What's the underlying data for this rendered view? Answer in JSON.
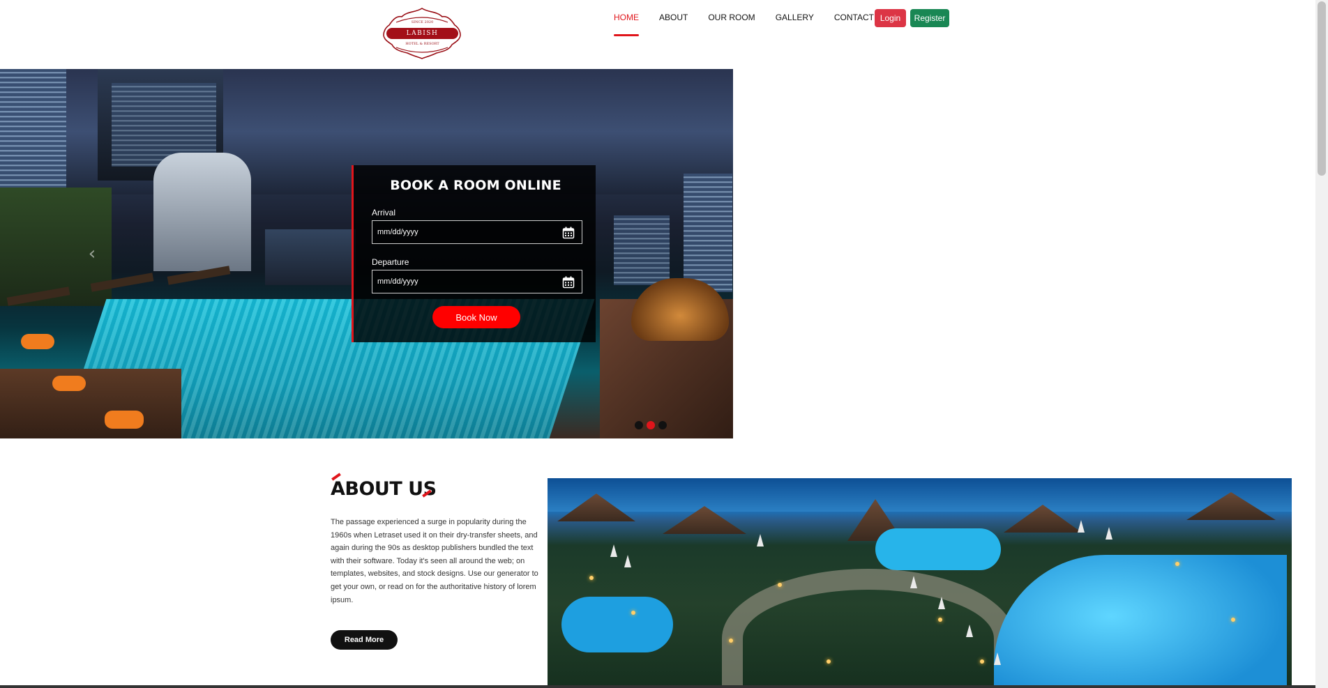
{
  "header": {
    "logo": {
      "top_text": "SINCE 2020",
      "name": "LABISH",
      "tagline": "HOTEL & RESORT"
    },
    "nav": [
      {
        "label": "HOME",
        "active": true
      },
      {
        "label": "ABOUT",
        "active": false
      },
      {
        "label": "OUR ROOM",
        "active": false
      },
      {
        "label": "GALLERY",
        "active": false
      },
      {
        "label": "CONTACT US",
        "active": false
      }
    ],
    "login_label": "Login",
    "register_label": "Register"
  },
  "booking": {
    "title": "BOOK A ROOM ONLINE",
    "arrival_label": "Arrival",
    "arrival_placeholder": "mm/dd/yyyy",
    "departure_label": "Departure",
    "departure_placeholder": "mm/dd/yyyy",
    "button_label": "Book Now"
  },
  "carousel": {
    "active_index": 1,
    "count": 3
  },
  "about": {
    "title": "ABOUT US",
    "text": "The passage experienced a surge in popularity during the 1960s when Letraset used it on their dry-transfer sheets, and again during the 90s as desktop publishers bundled the text with their software. Today it's seen all around the web; on templates, websites, and stock designs. Use our generator to get your own, or read on for the authoritative history of lorem ipsum.",
    "button_label": "Read More"
  },
  "colors": {
    "accent": "#e0151b",
    "login": "#dc3545",
    "register": "#198754"
  }
}
